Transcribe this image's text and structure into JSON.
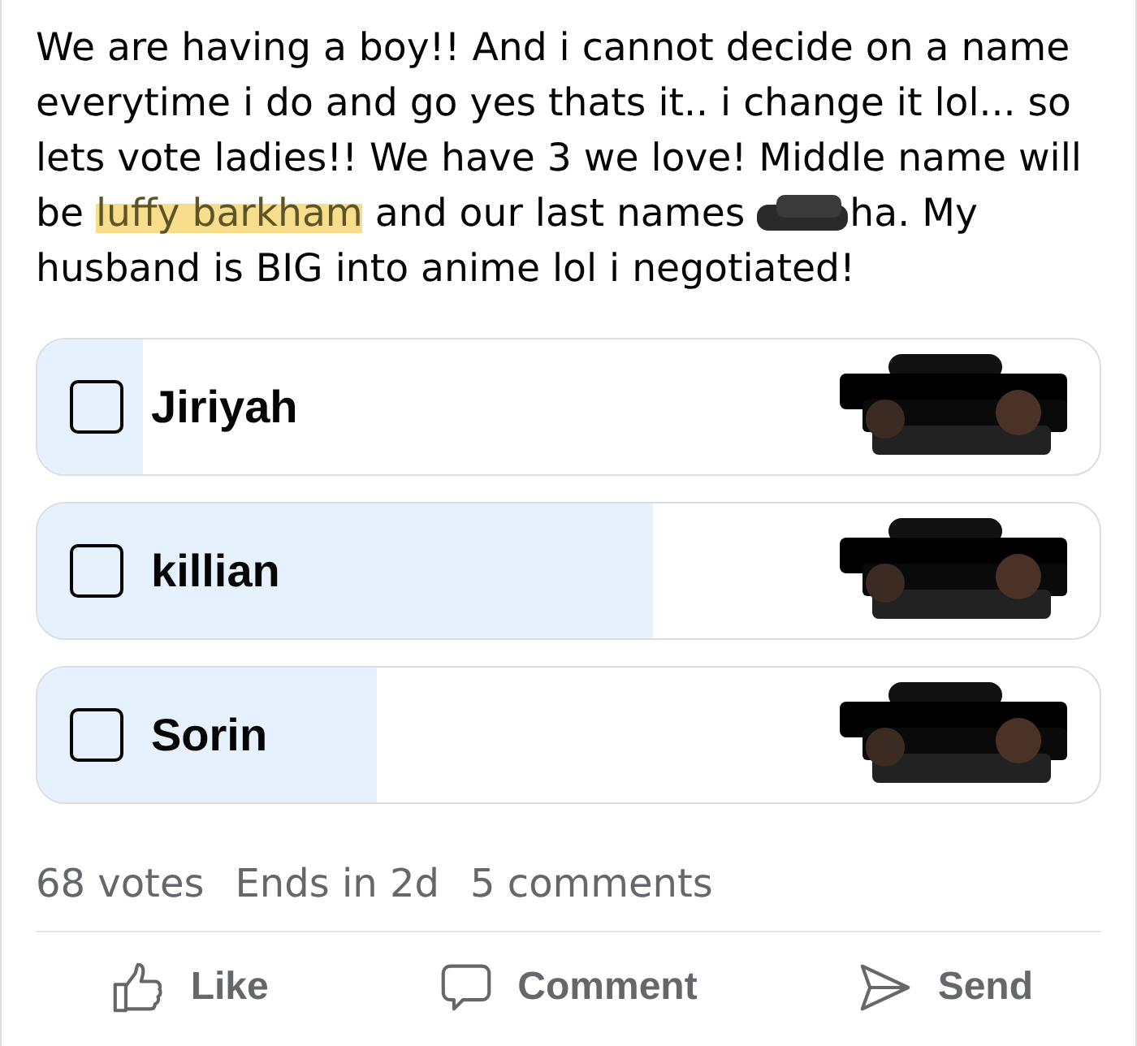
{
  "post": {
    "segments": [
      {
        "kind": "text",
        "text": "We are having a boy!! And i cannot decide on a name everytime i do and go yes thats it.. i change it lol... so lets vote ladies!! We have 3 we love! Middle name will be "
      },
      {
        "kind": "highlight",
        "text": "luffy barkham"
      },
      {
        "kind": "text",
        "text": " and our last names "
      },
      {
        "kind": "scribble"
      },
      {
        "kind": "text",
        "text": "ha. My husband is BIG into anime lol i negotiated!"
      }
    ]
  },
  "poll": {
    "options": [
      {
        "label": "Jiriyah",
        "checked": false,
        "level": 0.1
      },
      {
        "label": "killian",
        "checked": false,
        "level": 0.58
      },
      {
        "label": "Sorin",
        "checked": false,
        "level": 0.32
      }
    ]
  },
  "stats": [
    "68 votes",
    "Ends in 2d",
    "5 comments"
  ],
  "actions": [
    {
      "kind": "like",
      "label": "Like"
    },
    {
      "kind": "comment",
      "label": "Comment"
    },
    {
      "kind": "send",
      "label": "Send"
    }
  ]
}
